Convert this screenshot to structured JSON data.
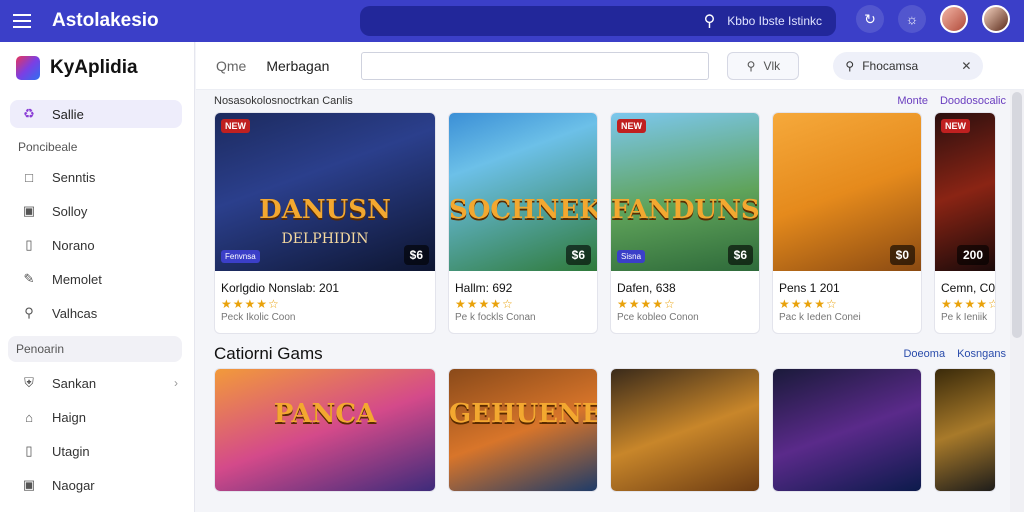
{
  "topbar": {
    "title": "Astolakesio",
    "search_text": "Kbbo Ibste Istinkc",
    "icons": [
      "hamburger-icon",
      "search-icon",
      "refresh-icon",
      "chat-icon"
    ]
  },
  "sidebar": {
    "brand": "KyAplidia",
    "active_item": "Sallie",
    "section1": "Poncibeale",
    "items1": [
      {
        "label": "Senntis",
        "icon": "grid-icon"
      },
      {
        "label": "Sollоy",
        "icon": "image-icon"
      },
      {
        "label": "Norano",
        "icon": "doc-icon"
      },
      {
        "label": "Memolet",
        "icon": "pen-icon"
      },
      {
        "label": "Valhcas",
        "icon": "search-icon"
      }
    ],
    "section2": "Penoarin",
    "items2": [
      {
        "label": "Sankan",
        "icon": "shield-icon",
        "chevron": true
      },
      {
        "label": "Haign",
        "icon": "home-icon"
      },
      {
        "label": "Utagin",
        "icon": "doc-icon"
      },
      {
        "label": "Naogar",
        "icon": "image-icon"
      }
    ]
  },
  "filterbar": {
    "label1": "Qme",
    "label2": "Merbagan",
    "input_value": "",
    "view_label": "Vlk",
    "find_label": "Fhocamsa"
  },
  "section1": {
    "title": "Nosasokolosnoctrkan Canlis",
    "links": [
      "Monte",
      "Doodosocalic"
    ]
  },
  "cards": [
    {
      "title": "Korlgdio Nonslab: 201",
      "meta": "Peck Ikolic Coon",
      "price": "$6",
      "badge": "NEW",
      "chip": "Fenvnsa",
      "art_title": "DANUSN",
      "art_sub": "DELPHIDIN",
      "bg": "linear-gradient(160deg,#1c2a5e 0%,#2b3f8c 40%,#0d1530 100%)"
    },
    {
      "title": "Hallm: 692",
      "meta": "Pe k fockls Conan",
      "price": "$6",
      "badge": "",
      "chip": "",
      "art_title": "SOCHNEK",
      "art_sub": "",
      "bg": "linear-gradient(160deg,#3b8fd6 0%,#6cc0e8 30%,#2f7a3a 100%)"
    },
    {
      "title": "Dafen, 638",
      "meta": "Pce kobleo Conon",
      "price": "$6",
      "badge": "NEW",
      "chip": "Sisna",
      "art_title": "FANDUNS",
      "art_sub": "",
      "bg": "linear-gradient(170deg,#7cc7ee 0%,#5fa35a 55%,#2e6a3a 100%)"
    },
    {
      "title": "Pens 1 201",
      "meta": "Pac k Ieden Conei",
      "price": "$0",
      "badge": "",
      "chip": "",
      "art_title": "",
      "art_sub": "",
      "bg": "linear-gradient(160deg,#f6a93b 0%,#e58a1c 50%,#8a4a12 100%)"
    },
    {
      "title": "Cemn, C0",
      "meta": "Pe k Ieniik",
      "price": "200",
      "badge": "NEW",
      "chip": "",
      "art_title": "",
      "art_sub": "",
      "bg": "linear-gradient(160deg,#2b0f0f 0%,#8a2414 50%,#1a0a0a 100%)"
    }
  ],
  "section2": {
    "title": "Catiorni Gams",
    "links": [
      "Doeoma",
      "Kosngans"
    ]
  },
  "cards2": [
    {
      "art_title": "PANCA",
      "bg": "linear-gradient(160deg,#f29a3a 0%,#d44a8a 50%,#3a2a7a 100%)"
    },
    {
      "art_title": "GEHUENER",
      "bg": "linear-gradient(160deg,#8a4a1a 0%,#d8752a 50%,#1a3a6a 100%)"
    },
    {
      "art_title": "",
      "bg": "linear-gradient(160deg,#3a2a1a 0%,#c8862a 50%,#6a3a12 100%)"
    },
    {
      "art_title": "",
      "bg": "linear-gradient(160deg,#1a1a3a 0%,#5a2a8a 50%,#0a1a4a 100%)"
    },
    {
      "art_title": "",
      "bg": "linear-gradient(160deg,#3a2a0a 0%,#a87a2a 50%,#1a1a1a 100%)"
    }
  ],
  "colors": {
    "accent": "#3b3fc8",
    "star": "#e9a20b",
    "link": "#6b3fc0"
  }
}
